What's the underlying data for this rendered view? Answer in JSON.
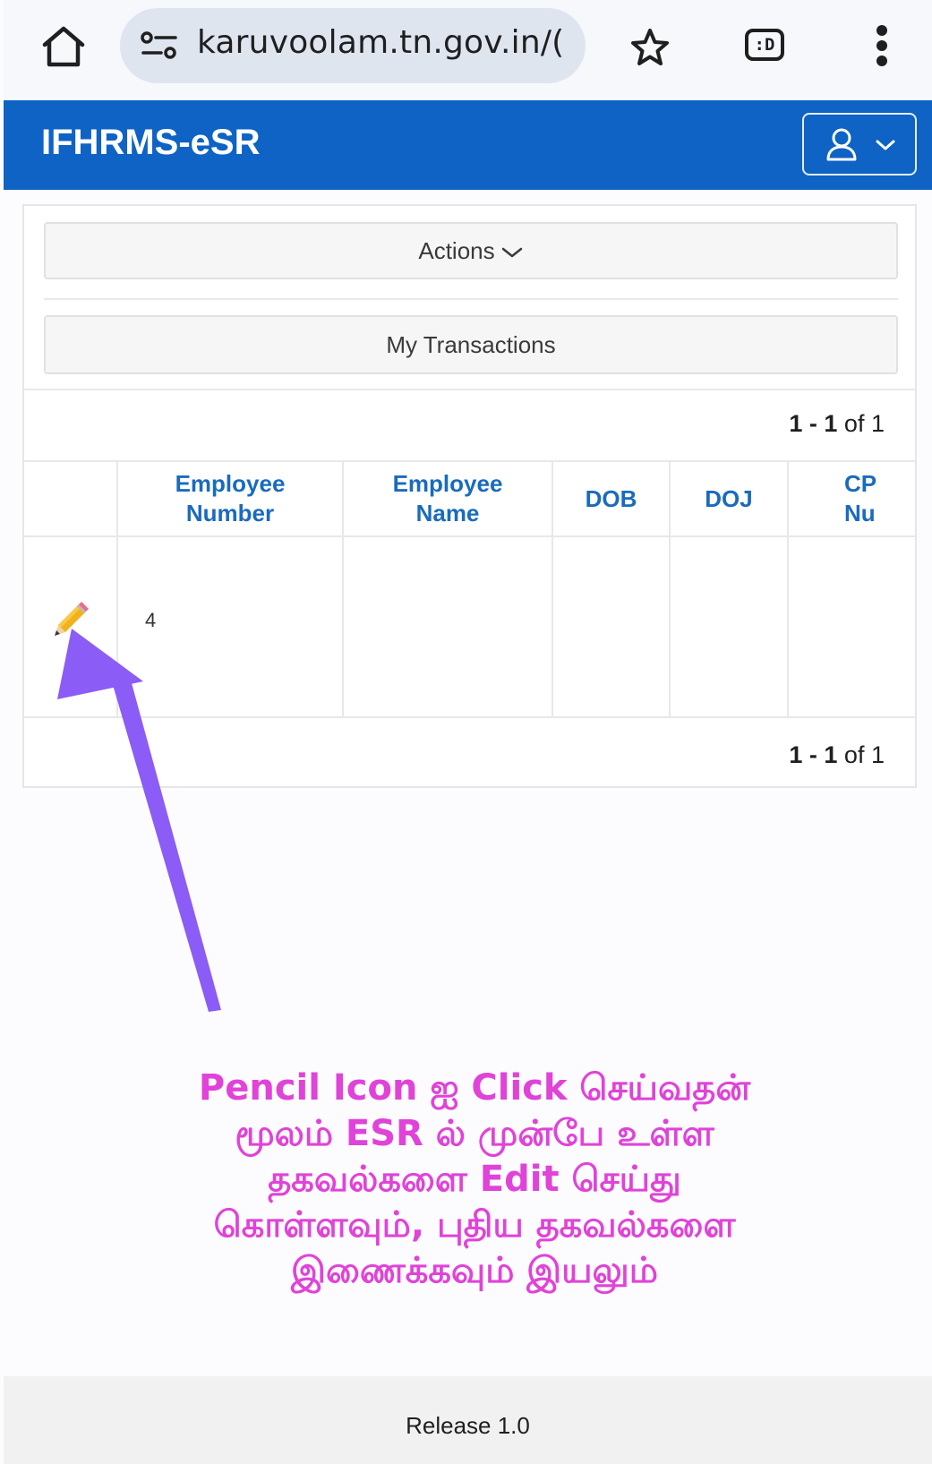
{
  "browser": {
    "url": "karuvoolam.tn.gov.in/(",
    "tabs_count_label": ":D"
  },
  "header": {
    "title": "IFHRMS-eSR"
  },
  "card": {
    "actions_label": "Actions",
    "transactions_label": "My Transactions",
    "pagination": {
      "range": "1 - 1",
      "of_label": "of",
      "total": "1"
    }
  },
  "table": {
    "columns": [
      {
        "line1": "",
        "line2": ""
      },
      {
        "line1": "Employee",
        "line2": "Number"
      },
      {
        "line1": "Employee",
        "line2": "Name"
      },
      {
        "line1": "DOB",
        "line2": ""
      },
      {
        "line1": "DOJ",
        "line2": ""
      },
      {
        "line1": "CP",
        "line2": "Nu"
      }
    ],
    "row": {
      "employee_number": "4"
    }
  },
  "annotation": {
    "lines": [
      "Pencil Icon ஐ Click செய்வதன்",
      "மூலம் ESR ல் முன்பே உள்ள",
      "தகவல்களை Edit செய்து",
      "கொள்ளவும், புதிய தகவல்களை",
      "இணைக்கவும் இயலும்"
    ],
    "color": "#e043d8",
    "arrow_color": "#8b5cf6"
  },
  "footer": {
    "release": "Release 1.0"
  },
  "colors": {
    "header_blue": "#0e63c4",
    "column_header": "#1a6bbd"
  }
}
